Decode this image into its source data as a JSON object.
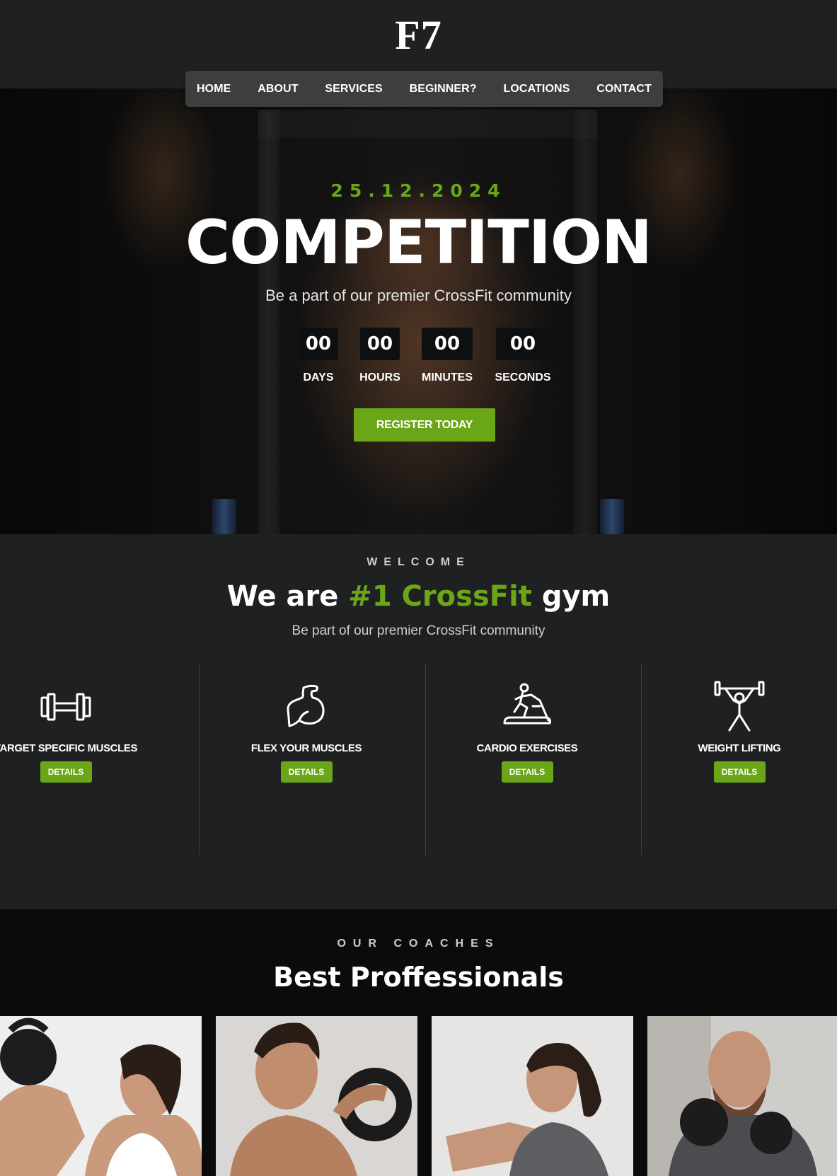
{
  "brand": {
    "logo": "F7"
  },
  "nav": {
    "items": [
      "HOME",
      "ABOUT",
      "SERVICES",
      "BEGINNER?",
      "LOCATIONS",
      "CONTACT"
    ]
  },
  "hero": {
    "date": "25.12.2024",
    "title": "COMPETITION",
    "subtitle": "Be a part of our premier CrossFit community",
    "countdown": [
      {
        "value": "00",
        "label": "DAYS"
      },
      {
        "value": "00",
        "label": "HOURS"
      },
      {
        "value": "00",
        "label": "MINUTES"
      },
      {
        "value": "00",
        "label": "SECONDS"
      }
    ],
    "cta": "REGISTER TODAY"
  },
  "welcome": {
    "kicker": "WELCOME",
    "title_pre": "We are ",
    "title_accent": "#1 CrossFit",
    "title_post": " gym",
    "subtitle": "Be part of our premier CrossFit community",
    "features": [
      {
        "name": "TARGET SPECIFIC MUSCLES",
        "button": "DETAILS",
        "icon": "dumbbell-icon"
      },
      {
        "name": "FLEX YOUR MUSCLES",
        "button": "DETAILS",
        "icon": "flexed-arm-icon"
      },
      {
        "name": "CARDIO EXERCISES",
        "button": "DETAILS",
        "icon": "treadmill-icon"
      },
      {
        "name": "WEIGHT LIFTING",
        "button": "DETAILS",
        "icon": "weightlifter-icon"
      }
    ]
  },
  "coaches": {
    "kicker": "OUR COACHES",
    "title": "Best Proffessionals"
  },
  "colors": {
    "accent": "#6aa617",
    "background": "#1f2022",
    "nav_background": "#3d3e40",
    "coaches_background": "#0b0b0b"
  }
}
